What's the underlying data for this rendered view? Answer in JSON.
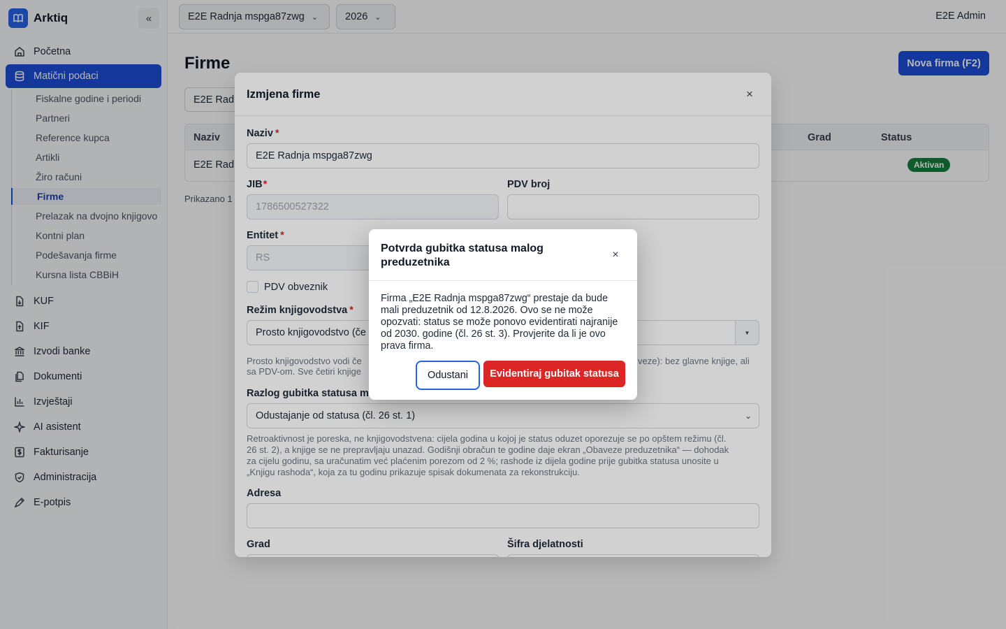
{
  "app": {
    "name": "Arktiq"
  },
  "header": {
    "company": "E2E Radnja mspga87zwg",
    "year": "2026",
    "user": "E2E Admin"
  },
  "sidebar": {
    "items": [
      {
        "label": "Početna",
        "icon": "home-icon"
      },
      {
        "label": "Matični podaci",
        "icon": "database-icon"
      },
      {
        "label": "KUF",
        "icon": "file-in-icon"
      },
      {
        "label": "KIF",
        "icon": "file-out-icon"
      },
      {
        "label": "Izvodi banke",
        "icon": "bank-icon"
      },
      {
        "label": "Dokumenti",
        "icon": "documents-icon"
      },
      {
        "label": "Izvještaji",
        "icon": "chart-icon"
      },
      {
        "label": "AI asistent",
        "icon": "sparkle-icon"
      },
      {
        "label": "Fakturisanje",
        "icon": "dollar-icon"
      },
      {
        "label": "Administracija",
        "icon": "shield-icon"
      },
      {
        "label": "E-potpis",
        "icon": "pen-icon"
      }
    ],
    "subitems": [
      "Fiskalne godine i periodi",
      "Partneri",
      "Reference kupca",
      "Artikli",
      "Žiro računi",
      "Firme",
      "Prelazak na dvojno knjigovo",
      "Kontni plan",
      "Podešavanja firme",
      "Kursna lista CBBiH"
    ]
  },
  "page": {
    "title": "Firme",
    "new_button": "Nova firma (F2)",
    "search_value": "E2E Radn",
    "columns": {
      "name": "Naziv",
      "city": "Grad",
      "status": "Status"
    },
    "row": {
      "name": "E2E Radn",
      "status": "Aktivan"
    },
    "shown_text": "Prikazano 1"
  },
  "edit_modal": {
    "title": "Izmjena firme",
    "name_label": "Naziv",
    "name_value": "E2E Radnja mspga87zwg",
    "jib_label": "JIB",
    "jib_value": "1786500527322",
    "pdv_label": "PDV broj",
    "pdv_value": "",
    "entity_label": "Entitet",
    "entity_value": "RS",
    "pdv_checkbox": "PDV obveznik",
    "regime_label": "Režim knjigovodstva",
    "regime_value": "Prosto knjigovodstvo (če",
    "regime_hint_1": "Prosto knjigovodstvo vodi če",
    "regime_hint_1_tail": "veze): bez glavne knjige, ali",
    "regime_hint_2": "sa PDV-om. Sve četiri knjige",
    "reason_label": "Razlog gubitka statusa ma",
    "reason_value": "Odustajanje od statusa (čl. 26 st. 1)",
    "reason_hint_1": "Retroaktivnost je poreska, ne knjigovodstvena: cijela godina u kojoj je status oduzet oporezuje se po opštem režimu (čl.",
    "reason_hint_2": "26 st. 2), a knjige se ne prepravljaju unazad. Godišnji obračun te godine daje ekran „Obaveze preduzetnika“ — dohodak",
    "reason_hint_3": "za cijelu godinu, sa uračunatim već plaćenim porezom od 2 %; rashode iz dijela godine prije gubitka statusa unosite u",
    "reason_hint_4": "„Knjigu rashoda“, koja za tu godinu prikazuje spisak dokumenata za rekonstrukciju.",
    "address_label": "Adresa",
    "city_label": "Grad",
    "activity_label": "Šifra djelatnosti",
    "required_mark": "*"
  },
  "confirm": {
    "title": "Potvrda gubitka statusa malog preduzetnika",
    "body": "Firma „E2E Radnja mspga87zwg“ prestaje da bude mali preduzetnik od 12.8.2026. Ovo se ne može opozvati: status se može ponovo evidentirati najranije od 2030. godine (čl. 26 st. 3). Provjerite da li je ovo prava firma.",
    "cancel": "Odustani",
    "confirm": "Evidentiraj gubitak statusa"
  },
  "colors": {
    "primary": "#1d4ed8",
    "danger": "#dc2626",
    "success": "#15803d"
  }
}
